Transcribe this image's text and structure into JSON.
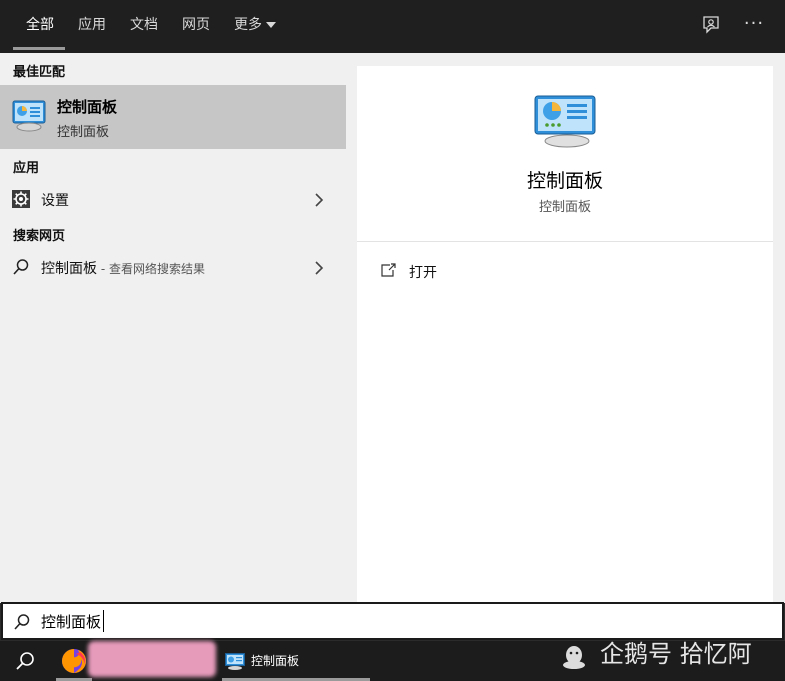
{
  "tabs": {
    "all": "全部",
    "apps": "应用",
    "documents": "文档",
    "web": "网页",
    "more": "更多"
  },
  "top_actions": {
    "more_label": "···"
  },
  "results": {
    "best_match_header": "最佳匹配",
    "best_match": {
      "title": "控制面板",
      "subtitle": "控制面板"
    },
    "apps_header": "应用",
    "apps": [
      {
        "label": "设置"
      }
    ],
    "web_header": "搜索网页",
    "web": [
      {
        "label": "控制面板",
        "suffix": " - 查看网络搜索结果"
      }
    ]
  },
  "preview": {
    "title": "控制面板",
    "subtitle": "控制面板",
    "actions": [
      {
        "label": "打开"
      }
    ]
  },
  "search": {
    "value": "控制面板"
  },
  "taskbar": {
    "app_label": "控制面板"
  },
  "watermark": {
    "text": "企鹅号 拾忆阿"
  },
  "colors": {
    "topbar": "#1f1f1f",
    "panel": "#f0f0f0",
    "selected": "#c6c6c6",
    "taskbar": "#1c1c1c"
  },
  "icons": {
    "feedback": "feedback-icon",
    "more": "ellipsis-icon",
    "control_panel": "control-panel-icon",
    "settings": "gear-icon",
    "web_search": "search-icon",
    "chevron": "chevron-right-icon",
    "open": "open-icon",
    "firefox": "firefox-icon",
    "watermark_logo": "penguin-icon"
  }
}
